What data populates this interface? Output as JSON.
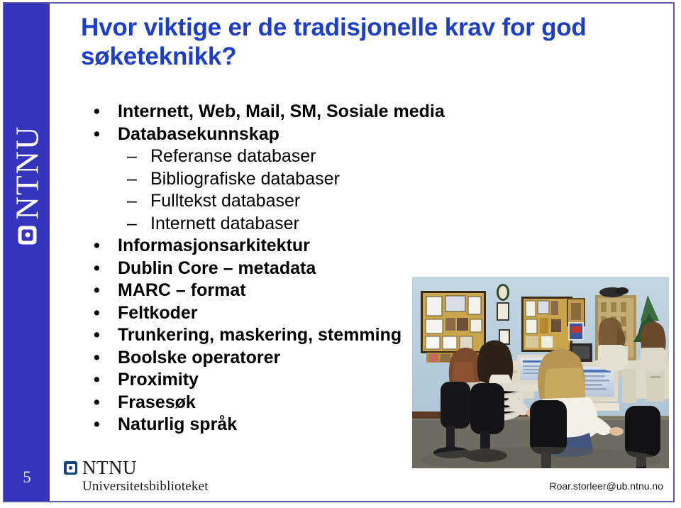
{
  "slide": {
    "number": "5",
    "title": "Hvor viktige er de tradisjonelle krav for god søketeknikk?",
    "accent_blue": "#1c3ec9",
    "sidebar_blue": "#3434bf",
    "border_color": "#5a5aa8"
  },
  "sidebar": {
    "logo_text": "NTNU",
    "logo_mark": "ntnu-square-icon"
  },
  "bullets": [
    {
      "level": 1,
      "marker": "•",
      "text": "Internett, Web, Mail, SM, Sosiale media"
    },
    {
      "level": 1,
      "marker": "•",
      "text": "Databasekunnskap"
    },
    {
      "level": 2,
      "marker": "–",
      "text": "Referanse databaser"
    },
    {
      "level": 2,
      "marker": "–",
      "text": "Bibliografiske databaser"
    },
    {
      "level": 2,
      "marker": "–",
      "text": "Fulltekst databaser"
    },
    {
      "level": 2,
      "marker": "–",
      "text": "Internett databaser"
    },
    {
      "level": 1,
      "marker": "•",
      "text": "Informasjonsarkitektur"
    },
    {
      "level": 1,
      "marker": "•",
      "text": "Dublin Core – metadata"
    },
    {
      "level": 1,
      "marker": "•",
      "text": "MARC – format"
    },
    {
      "level": 1,
      "marker": "•",
      "text": "Feltkoder"
    },
    {
      "level": 1,
      "marker": "•",
      "text": "Trunkering, maskering, stemming"
    },
    {
      "level": 1,
      "marker": "•",
      "text": "Boolske operatorer"
    },
    {
      "level": 1,
      "marker": "•",
      "text": "Proximity"
    },
    {
      "level": 1,
      "marker": "•",
      "text": "Frasesøk"
    },
    {
      "level": 1,
      "marker": "•",
      "text": "Naturlig språk"
    }
  ],
  "photo": {
    "alt": "Students seated at desktop computers in a library computer lab"
  },
  "footer": {
    "logo_text": "NTNU",
    "logo_subtitle": "Universitetsbiblioteket",
    "email": "Roar.storleer@ub.ntnu.no"
  }
}
